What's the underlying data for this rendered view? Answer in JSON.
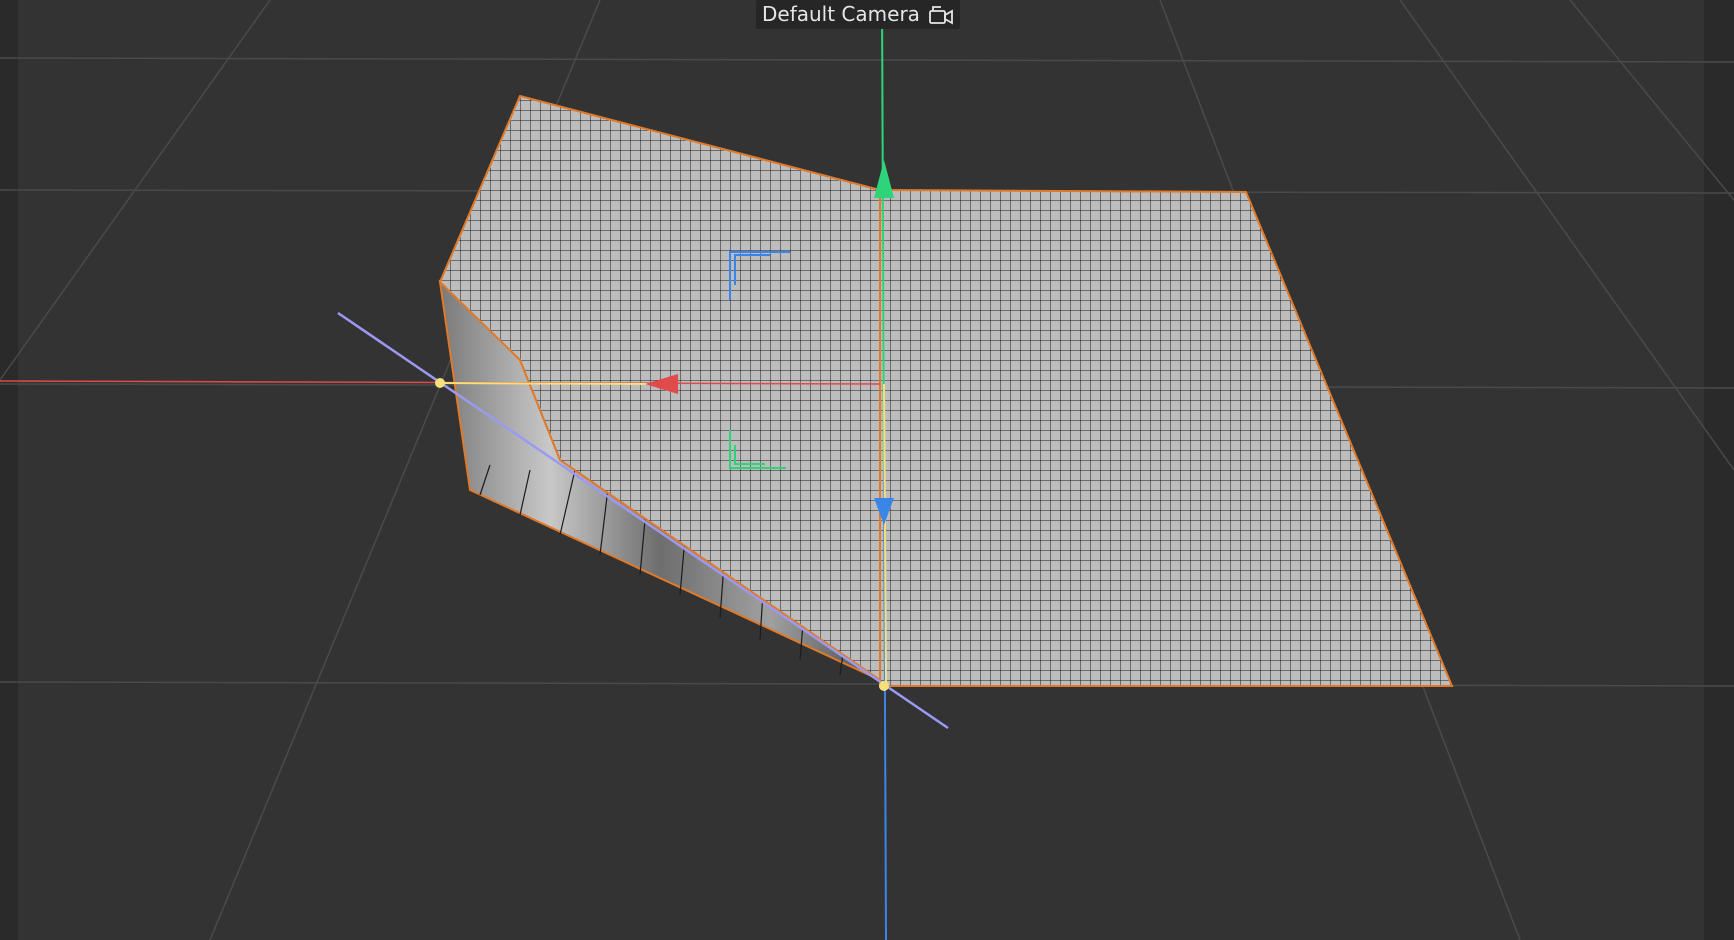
{
  "viewport": {
    "camera_label": "Default Camera",
    "camera_icon": "camera-icon"
  },
  "colors": {
    "background": "#333333",
    "grid_line": "#4a4a4a",
    "mesh_fill": "#b9b9b9",
    "mesh_wire": "#1b1b1b",
    "selection_outline": "#e07a2a",
    "axis_x": "#e04a4a",
    "axis_y": "#2ed47a",
    "axis_z": "#3a86e8",
    "guide_yellow": "#f5e07a",
    "guide_violet": "#9a9af2"
  }
}
